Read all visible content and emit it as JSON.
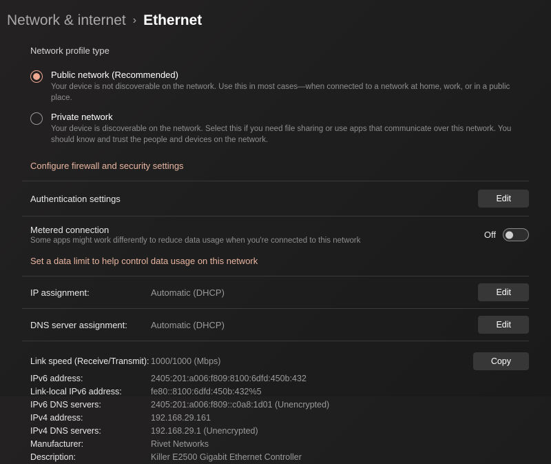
{
  "breadcrumb": {
    "parent": "Network & internet",
    "separator": "›",
    "current": "Ethernet"
  },
  "profile": {
    "section_title": "Network profile type",
    "public_label": "Public network (Recommended)",
    "public_desc": "Your device is not discoverable on the network. Use this in most cases—when connected to a network at home, work, or in a public place.",
    "private_label": "Private network",
    "private_desc": "Your device is discoverable on the network. Select this if you need file sharing or use apps that communicate over this network. You should know and trust the people and devices on the network.",
    "firewall_link": "Configure firewall and security settings"
  },
  "auth": {
    "label": "Authentication settings",
    "edit": "Edit"
  },
  "metered": {
    "label": "Metered connection",
    "desc": "Some apps might work differently to reduce data usage when you're connected to this network",
    "state": "Off",
    "limit_link": "Set a data limit to help control data usage on this network"
  },
  "ip": {
    "label": "IP assignment:",
    "value": "Automatic (DHCP)",
    "edit": "Edit"
  },
  "dns": {
    "label": "DNS server assignment:",
    "value": "Automatic (DHCP)",
    "edit": "Edit"
  },
  "info": {
    "copy": "Copy",
    "rows": [
      {
        "k": "Link speed (Receive/Transmit):",
        "v": "1000/1000 (Mbps)"
      },
      {
        "k": "IPv6 address:",
        "v": "2405:201:a006:f809:8100:6dfd:450b:432"
      },
      {
        "k": "Link-local IPv6 address:",
        "v": "fe80::8100:6dfd:450b:432%5"
      },
      {
        "k": "IPv6 DNS servers:",
        "v": "2405:201:a006:f809::c0a8:1d01 (Unencrypted)"
      },
      {
        "k": "IPv4 address:",
        "v": "192.168.29.161"
      },
      {
        "k": "IPv4 DNS servers:",
        "v": "192.168.29.1 (Unencrypted)"
      },
      {
        "k": "Manufacturer:",
        "v": "Rivet Networks"
      },
      {
        "k": "Description:",
        "v": "Killer E2500 Gigabit Ethernet Controller"
      }
    ]
  }
}
